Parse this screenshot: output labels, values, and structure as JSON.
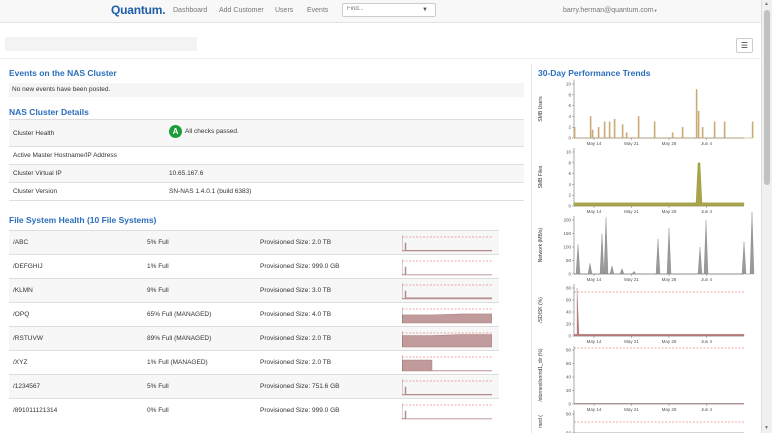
{
  "nav": {
    "brand": "Quantum.",
    "links": [
      "Dashboard",
      "Add Customer",
      "Users",
      "Events"
    ],
    "find_placeholder": "Find...",
    "user": "barry.herman@quantum.com"
  },
  "events": {
    "title": "Events on the NAS Cluster",
    "message": "No new events have been posted."
  },
  "details": {
    "title": "NAS Cluster Details",
    "rows": [
      {
        "label": "Cluster Health",
        "badge": "A",
        "value": "All checks passed."
      },
      {
        "label": "Active Master Hostname/IP Address",
        "value": ""
      },
      {
        "label": "Cluster Virtual IP",
        "value": "10.65.167.6"
      },
      {
        "label": "Cluster Version",
        "value": "SN-NAS 1.4.0.1 (build 6383)"
      }
    ]
  },
  "filesystems": {
    "title": "File System Health (10 File Systems)",
    "rows": [
      {
        "name": "/ABC",
        "full": "5% Full",
        "size": "Provisioned Size: 2.0 TB",
        "level": 0.05
      },
      {
        "name": "/DEFGHIJ",
        "full": "1% Full",
        "size": "Provisioned Size: 999.0 GB",
        "level": 0.01
      },
      {
        "name": "/KLMN",
        "full": "9% Full",
        "size": "Provisioned Size: 3.0 TB",
        "level": 0.09
      },
      {
        "name": "/OPQ",
        "full": "65% Full (MANAGED)",
        "size": "Provisioned Size: 4.0 TB",
        "level": 0.65
      },
      {
        "name": "/RSTUVW",
        "full": "89% Full (MANAGED)",
        "size": "Provisioned Size: 2.0 TB",
        "level": 0.89
      },
      {
        "name": "/XYZ",
        "full": "1% Full (MANAGED)",
        "size": "Provisioned Size: 2.0 TB",
        "level": 0.01
      },
      {
        "name": "/1234567",
        "full": "5% Full",
        "size": "Provisioned Size: 751.6 GB",
        "level": 0.05
      },
      {
        "name": "/891011121314",
        "full": "0% Full",
        "size": "Provisioned Size: 999.0 GB",
        "level": 0.0
      }
    ]
  },
  "perf": {
    "title": "30-Day Performance Trends",
    "x_ticks": [
      "May 14",
      "May 21",
      "May 28",
      "Jun 4"
    ],
    "charts": [
      {
        "ylabel": "SMB Users",
        "yticks": [
          "0",
          "2",
          "4",
          "6",
          "8",
          "10"
        ],
        "color": "#d2b37a"
      },
      {
        "ylabel": "SMB Files",
        "yticks": [
          "0",
          "2",
          "4",
          "6",
          "8",
          "10"
        ],
        "color": "#a8a44a"
      },
      {
        "ylabel": "Network (MB/s)",
        "yticks": [
          "0",
          "50",
          "100",
          "150",
          "200"
        ],
        "color": "#9a9a9a"
      },
      {
        "ylabel": "/SDISK (%)",
        "yticks": [
          "0",
          "20",
          "40",
          "60",
          "80"
        ],
        "color": "#b97b7b"
      },
      {
        "ylabel": "/stornext/snmd1_dir (%)",
        "yticks": [
          "0",
          "20",
          "40",
          "60",
          "80"
        ],
        "color": "#b97b7b"
      },
      {
        "ylabel": "med (",
        "yticks": [
          "60",
          "80"
        ],
        "color": "#b97b7b"
      }
    ]
  }
}
